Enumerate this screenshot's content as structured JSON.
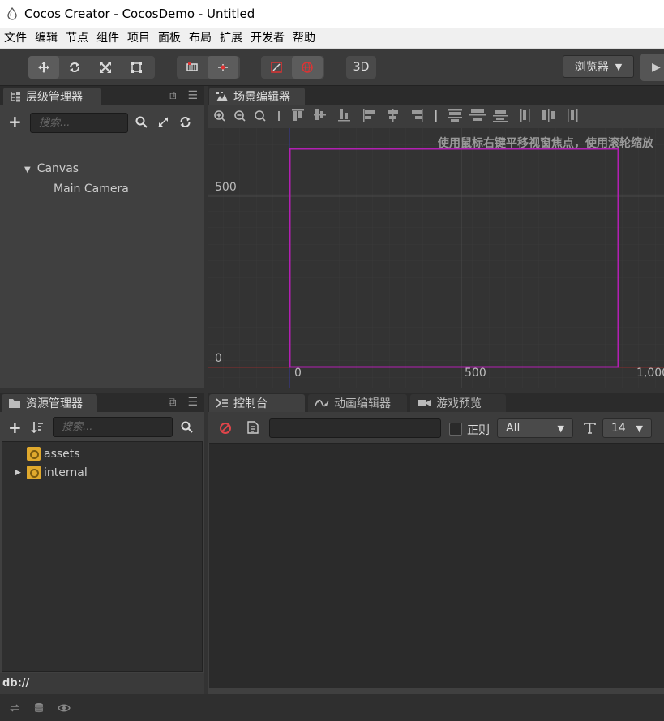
{
  "window": {
    "title": "Cocos Creator - CocosDemo - Untitled"
  },
  "menu": [
    "文件",
    "编辑",
    "节点",
    "组件",
    "项目",
    "面板",
    "布局",
    "扩展",
    "开发者",
    "帮助"
  ],
  "toolbar": {
    "mode_3d_label": "3D",
    "browser_label": "浏览器"
  },
  "hierarchy": {
    "tab_label": "层级管理器",
    "search_placeholder": "搜索...",
    "tree": {
      "root": "Canvas",
      "child": "Main Camera"
    }
  },
  "scene": {
    "tab_label": "场景编辑器",
    "hint": "使用鼠标右键平移视窗焦点，使用滚轮缩放",
    "axis": {
      "y_top": "500",
      "y_zero": "0",
      "x_zero": "0",
      "x_mid": "500",
      "x_end": "1,000"
    },
    "colors": {
      "frame": "#b31fb3",
      "x_axis": "#8b2c2c",
      "y_axis": "#3a3a9a"
    }
  },
  "assets": {
    "tab_label": "资源管理器",
    "search_placeholder": "搜索...",
    "items": [
      "assets",
      "internal"
    ],
    "db_path": "db://"
  },
  "console": {
    "tabs": [
      "控制台",
      "动画编辑器",
      "游戏预览"
    ],
    "regex_label": "正则",
    "level_select": "All",
    "font_size": "14"
  }
}
